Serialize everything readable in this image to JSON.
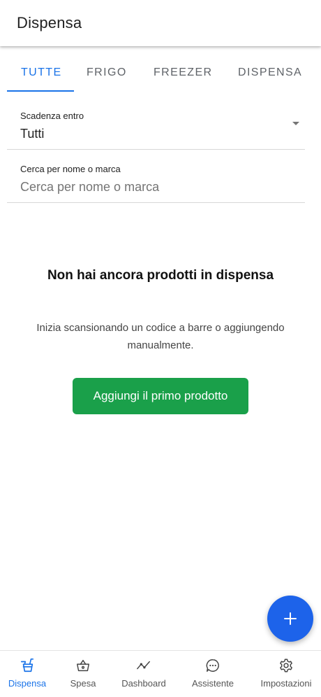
{
  "appbar": {
    "title": "Dispensa"
  },
  "tabs": [
    {
      "label": "TUTTE",
      "active": true
    },
    {
      "label": "FRIGO",
      "active": false
    },
    {
      "label": "FREEZER",
      "active": false
    },
    {
      "label": "DISPENSA",
      "active": false
    }
  ],
  "filter": {
    "expiry_label": "Scadenza entro",
    "expiry_value": "Tutti",
    "search_label": "Cerca per nome o marca",
    "search_placeholder": "Cerca per nome o marca"
  },
  "empty_state": {
    "title": "Non hai ancora prodotti in dispensa",
    "description": "Inizia scansionando un codice a barre o aggiungendo manualmente.",
    "button_label": "Aggiungi il primo prodotto"
  },
  "fab": {
    "icon": "plus-icon"
  },
  "bottom_nav": [
    {
      "label": "Dispensa",
      "icon": "food-icon",
      "active": true
    },
    {
      "label": "Spesa",
      "icon": "basket-icon",
      "active": false
    },
    {
      "label": "Dashboard",
      "icon": "trend-icon",
      "active": false
    },
    {
      "label": "Assistente",
      "icon": "chat-icon",
      "active": false
    },
    {
      "label": "Impostazioni",
      "icon": "gear-icon",
      "active": false
    }
  ],
  "colors": {
    "accent": "#1a73e8",
    "primary_button": "#1aa04a",
    "fab": "#1d63ea"
  }
}
